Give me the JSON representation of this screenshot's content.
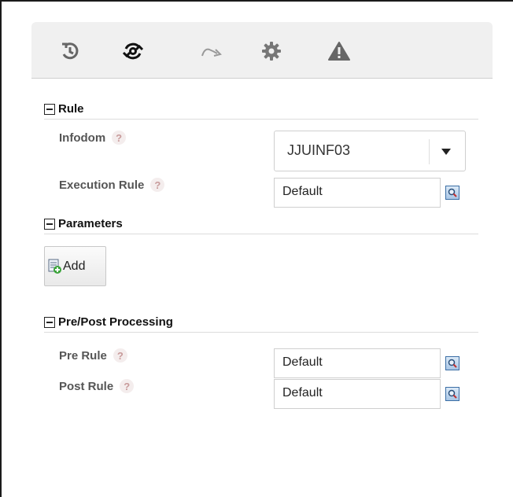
{
  "toolbar": {
    "icons": [
      "history-icon",
      "refresh-settings-icon",
      "redo-icon",
      "gear-icon",
      "warning-icon"
    ]
  },
  "sections": {
    "rule": {
      "title": "Rule"
    },
    "parameters": {
      "title": "Parameters"
    },
    "prepost": {
      "title": "Pre/Post Processing"
    }
  },
  "fields": {
    "infodom": {
      "label": "Infodom",
      "value": "JJUINF03"
    },
    "execution_rule": {
      "label": "Execution Rule",
      "value": "Default"
    },
    "pre_rule": {
      "label": "Pre Rule",
      "value": "Default"
    },
    "post_rule": {
      "label": "Post Rule",
      "value": "Default"
    }
  },
  "help_glyph": "?",
  "parameters_add_label": "Add",
  "colors": {
    "toolbar_bg": "#f0f0f0",
    "help_bg": "#f4eded",
    "help_fg": "#c89b9b",
    "lookup": "#3b6ea5"
  }
}
